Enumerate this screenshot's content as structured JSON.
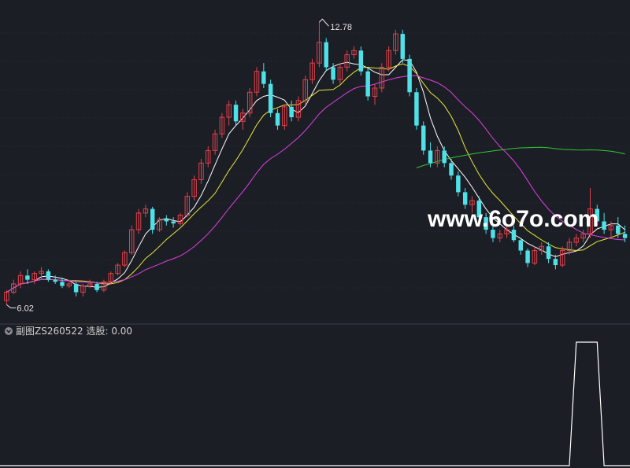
{
  "watermark": "www.6o7o.com",
  "sub_panel": {
    "label": "副图ZS260522 选股: 0.00"
  },
  "colors": {
    "background": "#1c1e26",
    "up": "#e0414a",
    "down": "#4fe0e8",
    "ma_white": "#ffffff",
    "ma_yellow": "#e8e83a",
    "ma_magenta": "#e040e0",
    "ma_green": "#32c832",
    "signal": "#ffffff"
  },
  "chart_data": [
    {
      "type": "candlestick",
      "price_labels": {
        "high": "12.78",
        "low": "6.02"
      },
      "ylim": [
        5.8,
        13.2
      ],
      "candles": [
        [
          6.1,
          6.35,
          6.0,
          6.3
        ],
        [
          6.3,
          6.6,
          6.25,
          6.5
        ],
        [
          6.5,
          6.8,
          6.4,
          6.7
        ],
        [
          6.7,
          6.85,
          6.5,
          6.6
        ],
        [
          6.6,
          6.8,
          6.5,
          6.75
        ],
        [
          6.75,
          6.9,
          6.6,
          6.8
        ],
        [
          6.8,
          6.85,
          6.55,
          6.6
        ],
        [
          6.6,
          6.7,
          6.5,
          6.55
        ],
        [
          6.55,
          6.65,
          6.4,
          6.45
        ],
        [
          6.45,
          6.6,
          6.4,
          6.5
        ],
        [
          6.5,
          6.55,
          6.2,
          6.3
        ],
        [
          6.3,
          6.5,
          6.2,
          6.45
        ],
        [
          6.45,
          6.6,
          6.4,
          6.5
        ],
        [
          6.5,
          6.55,
          6.3,
          6.35
        ],
        [
          6.35,
          6.6,
          6.3,
          6.55
        ],
        [
          6.55,
          6.8,
          6.5,
          6.75
        ],
        [
          6.75,
          7.0,
          6.7,
          6.95
        ],
        [
          6.95,
          7.3,
          6.9,
          7.25
        ],
        [
          7.25,
          7.9,
          7.2,
          7.8
        ],
        [
          7.8,
          8.3,
          7.7,
          8.2
        ],
        [
          8.2,
          8.4,
          8.1,
          8.3
        ],
        [
          8.3,
          8.35,
          7.7,
          7.8
        ],
        [
          7.8,
          8.1,
          7.75,
          8.05
        ],
        [
          8.05,
          8.15,
          7.9,
          8.0
        ],
        [
          8.0,
          8.1,
          7.85,
          7.95
        ],
        [
          7.95,
          8.2,
          7.9,
          8.15
        ],
        [
          8.15,
          8.7,
          8.1,
          8.6
        ],
        [
          8.6,
          9.1,
          8.5,
          9.0
        ],
        [
          9.0,
          9.5,
          8.9,
          9.4
        ],
        [
          9.4,
          9.8,
          9.3,
          9.7
        ],
        [
          9.7,
          10.2,
          9.6,
          10.1
        ],
        [
          10.1,
          10.6,
          10.0,
          10.5
        ],
        [
          10.5,
          10.9,
          10.3,
          10.8
        ],
        [
          10.8,
          10.9,
          10.3,
          10.4
        ],
        [
          10.4,
          10.7,
          10.2,
          10.6
        ],
        [
          10.6,
          11.2,
          10.5,
          11.1
        ],
        [
          11.1,
          11.7,
          11.0,
          11.6
        ],
        [
          11.6,
          11.8,
          11.2,
          11.3
        ],
        [
          11.3,
          11.4,
          10.5,
          10.6
        ],
        [
          10.6,
          10.7,
          10.2,
          10.3
        ],
        [
          10.3,
          10.8,
          10.2,
          10.75
        ],
        [
          10.75,
          10.9,
          10.4,
          10.5
        ],
        [
          10.5,
          11.0,
          10.4,
          10.9
        ],
        [
          10.9,
          11.5,
          10.8,
          11.4
        ],
        [
          11.4,
          11.9,
          11.3,
          11.8
        ],
        [
          11.8,
          12.78,
          11.7,
          12.3
        ],
        [
          12.3,
          12.4,
          11.6,
          11.7
        ],
        [
          11.7,
          11.8,
          11.3,
          11.4
        ],
        [
          11.4,
          11.8,
          11.3,
          11.7
        ],
        [
          11.7,
          12.1,
          11.6,
          12.0
        ],
        [
          12.0,
          12.2,
          11.9,
          12.1
        ],
        [
          12.1,
          12.2,
          11.5,
          11.6
        ],
        [
          11.6,
          11.7,
          10.9,
          11.0
        ],
        [
          11.0,
          11.3,
          10.8,
          11.2
        ],
        [
          11.2,
          11.8,
          11.1,
          11.7
        ],
        [
          11.7,
          12.2,
          11.6,
          12.1
        ],
        [
          12.1,
          12.6,
          12.0,
          12.5
        ],
        [
          12.5,
          12.6,
          11.8,
          11.9
        ],
        [
          11.9,
          12.0,
          11.0,
          11.1
        ],
        [
          11.1,
          11.2,
          10.2,
          10.3
        ],
        [
          10.3,
          10.4,
          9.6,
          9.7
        ],
        [
          9.7,
          9.9,
          9.3,
          9.4
        ],
        [
          9.4,
          9.8,
          9.3,
          9.7
        ],
        [
          9.7,
          9.8,
          9.3,
          9.4
        ],
        [
          9.4,
          9.5,
          9.0,
          9.1
        ],
        [
          9.1,
          9.2,
          8.6,
          8.7
        ],
        [
          8.7,
          8.8,
          8.3,
          8.4
        ],
        [
          8.4,
          8.6,
          8.2,
          8.5
        ],
        [
          8.5,
          8.6,
          8.0,
          8.1
        ],
        [
          8.1,
          8.2,
          7.7,
          7.8
        ],
        [
          7.8,
          7.9,
          7.5,
          7.6
        ],
        [
          7.6,
          7.8,
          7.5,
          7.7
        ],
        [
          7.7,
          7.9,
          7.6,
          7.8
        ],
        [
          7.8,
          7.9,
          7.5,
          7.55
        ],
        [
          7.55,
          7.6,
          7.2,
          7.3
        ],
        [
          7.3,
          7.35,
          6.9,
          7.0
        ],
        [
          7.0,
          7.4,
          6.95,
          7.3
        ],
        [
          7.3,
          7.5,
          7.2,
          7.4
        ],
        [
          7.4,
          7.5,
          7.0,
          7.1
        ],
        [
          7.1,
          7.2,
          6.85,
          6.95
        ],
        [
          6.95,
          7.4,
          6.9,
          7.3
        ],
        [
          7.3,
          7.6,
          7.2,
          7.5
        ],
        [
          7.5,
          7.7,
          7.4,
          7.6
        ],
        [
          7.6,
          7.8,
          7.5,
          7.7
        ],
        [
          7.7,
          8.8,
          7.6,
          8.3
        ],
        [
          8.3,
          8.4,
          7.9,
          8.0
        ],
        [
          8.0,
          8.2,
          7.7,
          7.8
        ],
        [
          7.8,
          8.0,
          7.6,
          7.9
        ],
        [
          7.9,
          8.1,
          7.6,
          7.7
        ],
        [
          7.7,
          7.9,
          7.5,
          7.6
        ]
      ]
    },
    {
      "type": "line",
      "name": "ZS260522",
      "ylim": [
        0,
        1
      ],
      "x": [
        0,
        81,
        82,
        85,
        86,
        89
      ],
      "values": [
        0,
        0,
        1,
        1,
        0,
        0
      ]
    }
  ]
}
